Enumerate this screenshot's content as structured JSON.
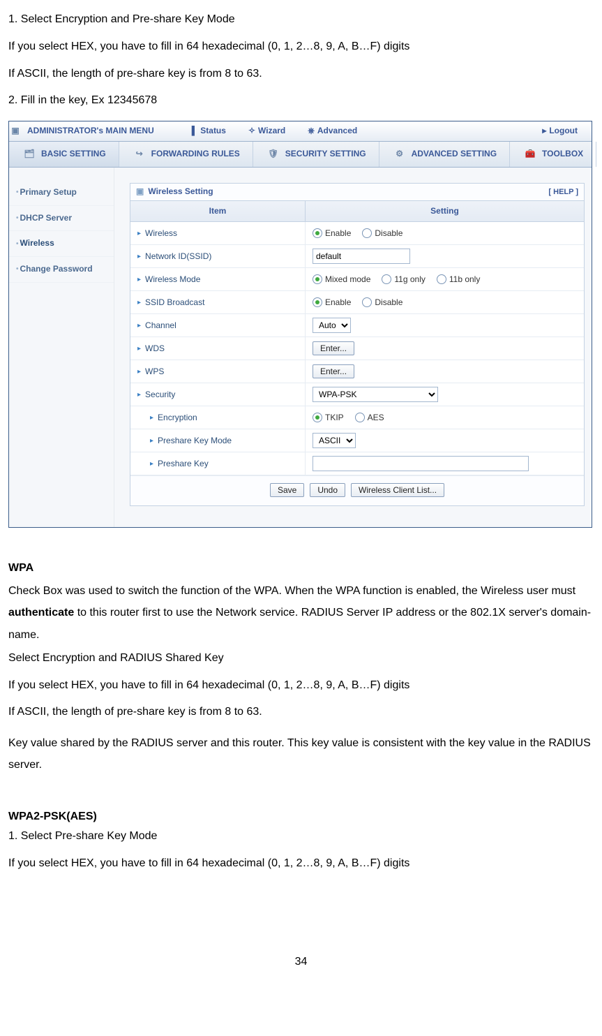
{
  "intro": {
    "step1": "1. Select Encryption and Pre-share Key Mode",
    "hex": "If you select HEX, you have to fill in 64 hexadecimal (0, 1, 2…8, 9, A, B…F) digits",
    "ascii": "If ASCII, the length of pre-share key is from 8 to 63.",
    "step2": "2. Fill in the key, Ex 12345678"
  },
  "topmenu": {
    "title": "ADMINISTRATOR's MAIN MENU",
    "items": [
      "Status",
      "Wizard",
      "Advanced"
    ],
    "logout": "Logout"
  },
  "tabs": [
    "BASIC SETTING",
    "FORWARDING RULES",
    "SECURITY SETTING",
    "ADVANCED SETTING",
    "TOOLBOX"
  ],
  "sidebar": [
    "Primary Setup",
    "DHCP Server",
    "Wireless",
    "Change Password"
  ],
  "panel": {
    "title": "Wireless Setting",
    "help": "[ HELP ]",
    "headers": [
      "Item",
      "Setting"
    ],
    "rows": {
      "wireless": {
        "label": "Wireless",
        "opts": [
          "Enable",
          "Disable"
        ]
      },
      "ssid": {
        "label": "Network ID(SSID)",
        "value": "default"
      },
      "mode": {
        "label": "Wireless Mode",
        "opts": [
          "Mixed mode",
          "11g only",
          "11b only"
        ]
      },
      "ssidb": {
        "label": "SSID Broadcast",
        "opts": [
          "Enable",
          "Disable"
        ]
      },
      "channel": {
        "label": "Channel",
        "value": "Auto"
      },
      "wds": {
        "label": "WDS",
        "btn": "Enter..."
      },
      "wps": {
        "label": "WPS",
        "btn": "Enter..."
      },
      "security": {
        "label": "Security",
        "value": "WPA-PSK"
      },
      "enc": {
        "label": "Encryption",
        "opts": [
          "TKIP",
          "AES"
        ]
      },
      "pkm": {
        "label": "Preshare Key Mode",
        "value": "ASCII"
      },
      "pk": {
        "label": "Preshare Key",
        "value": ""
      }
    },
    "buttons": [
      "Save",
      "Undo",
      "Wireless Client List..."
    ]
  },
  "wpa": {
    "heading": "WPA",
    "body_pre": "Check Box was used to switch the function of the WPA. When the WPA function is enabled, the Wireless user must ",
    "bold": "authenticate",
    "body_post": " to this router first to use the Network service. RADIUS Server IP address or the 802.1X server's domain-name.",
    "sel": "Select Encryption and RADIUS Shared Key",
    "hex": "If you select HEX, you have to fill in 64 hexadecimal (0, 1, 2…8, 9, A, B…F) digits",
    "ascii": "If ASCII, the length of pre-share key is from 8 to 63.",
    "key": "Key value shared by the RADIUS server and this router. This key value is consistent with the key value in the RADIUS server."
  },
  "wpa2": {
    "heading": "WPA2-PSK(AES)",
    "step1": "1. Select Pre-share Key Mode",
    "hex": "If you select HEX, you have to fill in 64 hexadecimal (0, 1, 2…8, 9, A, B…F) digits"
  },
  "page_number": "34"
}
